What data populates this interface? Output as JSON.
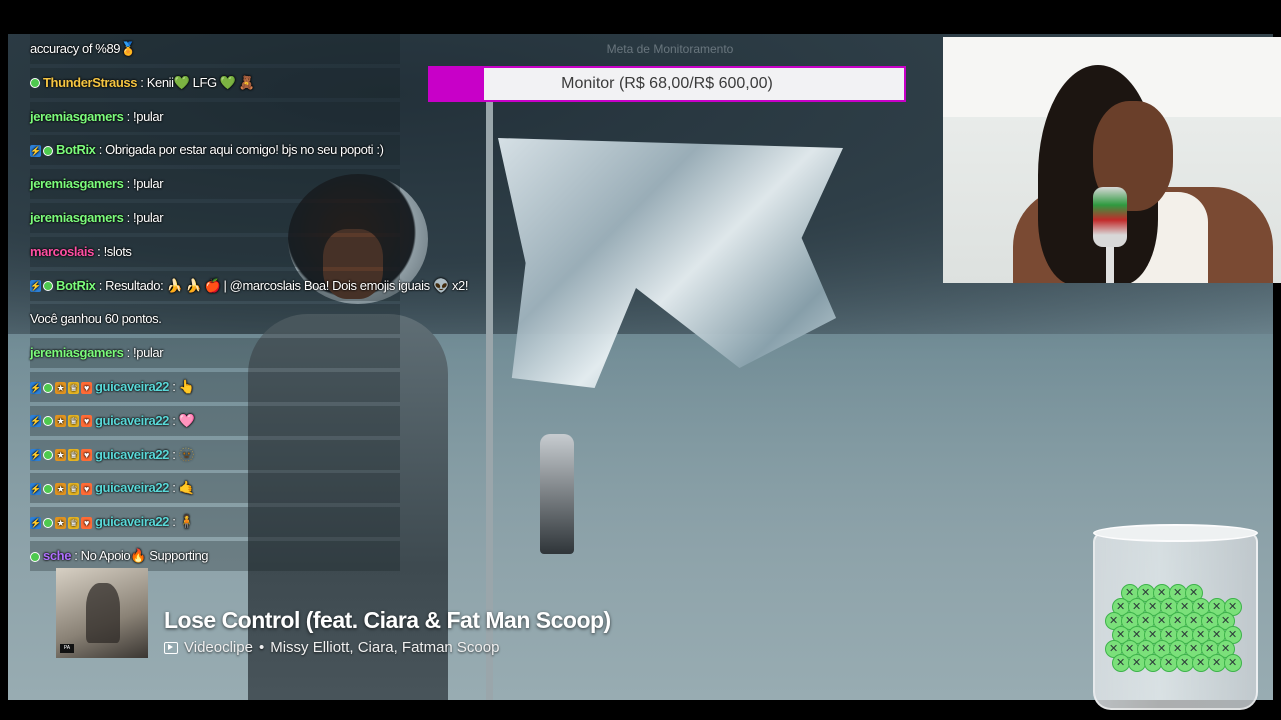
{
  "chat": {
    "messages": [
      {
        "badges": [],
        "user": "",
        "text": "accuracy of %89",
        "emoji": "🏅",
        "user_color": "#ffffff"
      },
      {
        "badges": [
          "dot"
        ],
        "user": "ThunderStrauss",
        "text": " : Kenii",
        "emoji": "💚 LFG 💚 🧸",
        "user_color": "#f5c542"
      },
      {
        "badges": [],
        "user": "jeremiasgamers",
        "text": " : !pular",
        "emoji": "",
        "user_color": "#7cfc7c"
      },
      {
        "badges": [
          "bot",
          "dot"
        ],
        "user": "BotRix",
        "text": " : Obrigada por estar aqui comigo! bjs no seu popoti :)",
        "emoji": "",
        "user_color": "#7cfc7c"
      },
      {
        "badges": [],
        "user": "jeremiasgamers",
        "text": " : !pular",
        "emoji": "",
        "user_color": "#7cfc7c"
      },
      {
        "badges": [],
        "user": "jeremiasgamers",
        "text": " : !pular",
        "emoji": "",
        "user_color": "#7cfc7c"
      },
      {
        "badges": [],
        "user": "marcoslais",
        "text": " : !slots",
        "emoji": "",
        "user_color": "#ff4fa3"
      },
      {
        "badges": [
          "bot",
          "dot"
        ],
        "user": "BotRix",
        "text": " : Resultado: 🍌 🍌 🍎 | @marcoslais Boa! Dois emojis iguais 👽 x2!",
        "emoji": "",
        "user_color": "#7cfc7c"
      },
      {
        "badges": [],
        "user": "",
        "text": "Você ganhou 60 pontos.",
        "emoji": "",
        "user_color": "#ffffff"
      },
      {
        "badges": [],
        "user": "jeremiasgamers",
        "text": " : !pular",
        "emoji": "",
        "user_color": "#7cfc7c"
      },
      {
        "badges": [
          "bot",
          "dot",
          "gift",
          "crown",
          "heart"
        ],
        "user": "guicaveira22",
        "text": " : ",
        "emoji": "👆",
        "user_color": "#5ad8d8"
      },
      {
        "badges": [
          "bot",
          "dot",
          "gift",
          "crown",
          "heart"
        ],
        "user": "guicaveira22",
        "text": " : ",
        "emoji": "🩷",
        "user_color": "#5ad8d8"
      },
      {
        "badges": [
          "bot",
          "dot",
          "gift",
          "crown",
          "heart"
        ],
        "user": "guicaveira22",
        "text": " : ",
        "emoji": "🫥",
        "user_color": "#5ad8d8"
      },
      {
        "badges": [
          "bot",
          "dot",
          "gift",
          "crown",
          "heart"
        ],
        "user": "guicaveira22",
        "text": " : ",
        "emoji": "🤙",
        "user_color": "#5ad8d8"
      },
      {
        "badges": [
          "bot",
          "dot",
          "gift",
          "crown",
          "heart"
        ],
        "user": "guicaveira22",
        "text": " : ",
        "emoji": "🧍",
        "user_color": "#5ad8d8"
      },
      {
        "badges": [
          "dot"
        ],
        "user": "sche",
        "text": " : No Apoio",
        "emoji": "🔥 Supporting",
        "user_color": "#b070ff"
      }
    ]
  },
  "monitor": {
    "label": "Monitor (R$ 68,00/R$ 600,00)",
    "progress": 0.113,
    "accent": "#c800c8",
    "faded_title": "Meta de Monitoramento"
  },
  "now_playing": {
    "title": "Lose Control (feat. Ciara & Fat Man Scoop)",
    "type": "Videoclipe",
    "separator": "•",
    "artists": "Missy Elliott, Ciara, Fatman Scoop",
    "cover_badge": "PA"
  },
  "icons": {
    "play": "video-play-icon",
    "jar": "tip-jar-icon",
    "token": "cross-token-icon"
  }
}
